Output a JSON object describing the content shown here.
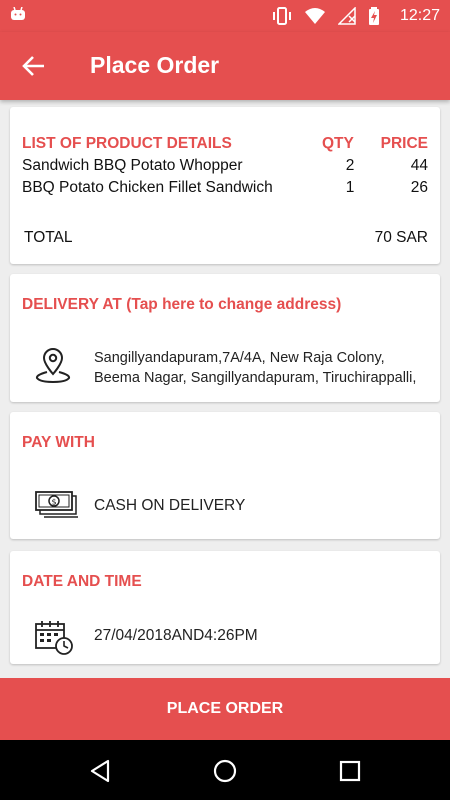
{
  "status_bar": {
    "time": "12:27"
  },
  "app_bar": {
    "title": "Place Order"
  },
  "products": {
    "section_title": "LIST OF PRODUCT DETAILS",
    "qty_header": "QTY",
    "price_header": "PRICE",
    "items": [
      {
        "name": "Sandwich BBQ Potato Whopper",
        "qty": "2",
        "price": "44"
      },
      {
        "name": "BBQ Potato Chicken Fillet Sandwich",
        "qty": "1",
        "price": "26"
      }
    ],
    "total_label": "TOTAL",
    "total_value": "70 SAR"
  },
  "delivery": {
    "section_title": "DELIVERY AT (Tap here to change address)",
    "address_line1": "Sangillyandapuram,7A/4A, New Raja Colony,",
    "address_line2": "Beema Nagar, Sangillyandapuram, Tiruchirappalli,"
  },
  "payment": {
    "section_title": "PAY WITH",
    "method": "CASH ON DELIVERY"
  },
  "datetime": {
    "section_title": "DATE AND TIME",
    "value": "27/04/2018AND4:26PM"
  },
  "action": {
    "place_order_label": "PLACE ORDER"
  },
  "colors": {
    "accent": "#e54f4f",
    "background": "#eeeeee",
    "card": "#ffffff"
  }
}
